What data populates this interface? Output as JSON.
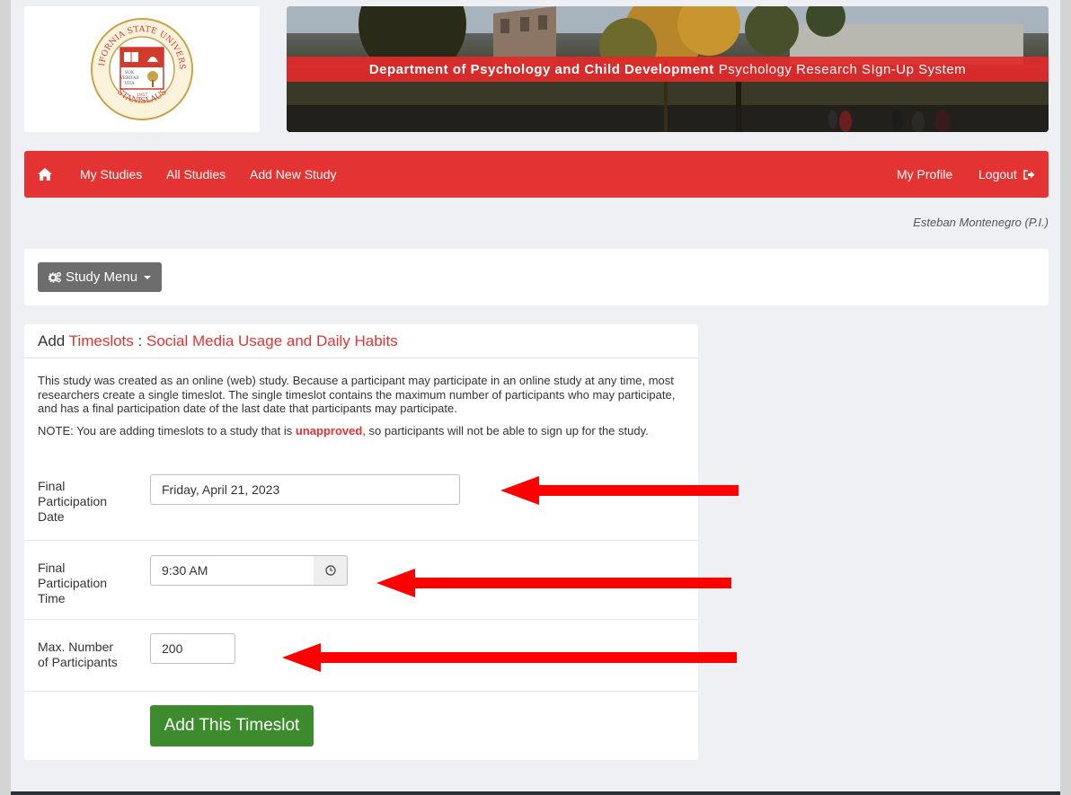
{
  "header": {
    "seal_text": {
      "arc_top": "CALIFORNIA STATE UNIVERSITY",
      "arc_bottom": "STANISLAUS",
      "motto": [
        "VOX",
        "VERITAS",
        "VITA"
      ],
      "year": "1957"
    },
    "banner_bold": "Department of Psychology and Child Development",
    "banner_rest": "Psychology Research SIgn-Up System"
  },
  "nav": {
    "home_icon": "home-icon",
    "left_items": [
      "My Studies",
      "All Studies",
      "Add New Study"
    ],
    "right_items": [
      "My Profile",
      "Logout"
    ],
    "logout_icon": "sign-out-icon"
  },
  "user_display": "Esteban Montenegro (P.I.)",
  "study_menu": {
    "icon": "gears-icon",
    "label": "Study Menu"
  },
  "panel": {
    "title_prefix": "Add",
    "title_link": "Timeslots",
    "title_sep": ":",
    "study_name": "Social Media Usage and Daily Habits",
    "intro": "This study was created as an online (web) study. Because a participant may participate in an online study at any time, most researchers create a single timeslot. The single timeslot contains the maximum number of participants who may participate, and has a final participation date of the last date that participants may participate.",
    "note_before": "NOTE: You are adding timeslots to a study that is",
    "note_flag": "unapproved",
    "note_after": ", so participants will not be able to sign up for the study."
  },
  "form": {
    "date_label": [
      "Final",
      "Participation",
      "Date"
    ],
    "date_value": "Friday, April 21, 2023",
    "time_label": [
      "Final",
      "Participation",
      "Time"
    ],
    "time_value": "9:30 AM",
    "time_icon": "clock-icon",
    "max_label": [
      "Max. Number",
      "of Participants"
    ],
    "max_value": "200",
    "submit_label": "Add This Timeslot"
  },
  "colors": {
    "brand_red": "#e43333",
    "submit_green": "#3c8b2c",
    "annotation_red": "#ff0000"
  }
}
